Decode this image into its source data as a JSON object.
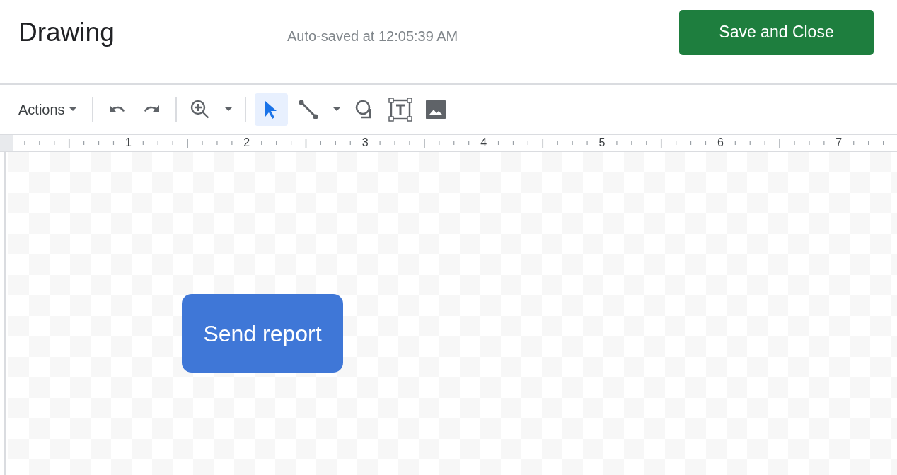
{
  "header": {
    "title": "Drawing",
    "status": "Auto-saved at 12:05:39 AM",
    "save_button": "Save and Close"
  },
  "toolbar": [
    {
      "kind": "menu",
      "label": "Actions"
    },
    {
      "kind": "divider"
    },
    {
      "kind": "tool",
      "selected": false
    },
    {
      "kind": "tool",
      "selected": false
    },
    {
      "kind": "divider"
    },
    {
      "kind": "tool",
      "selected": false
    },
    {
      "kind": "caret"
    },
    {
      "kind": "divider"
    },
    {
      "kind": "tool",
      "selected": true
    },
    {
      "kind": "tool",
      "selected": false
    },
    {
      "kind": "caret"
    },
    {
      "kind": "tool",
      "selected": false
    },
    {
      "kind": "tool",
      "selected": false
    },
    {
      "kind": "tool",
      "selected": false
    }
  ],
  "ruler": {
    "labels": [
      "1",
      "2",
      "3",
      "4",
      "5",
      "6",
      "7"
    ]
  },
  "canvas": {
    "shapes": [
      {
        "kind": "rounded_rectangle",
        "text": "Send report",
        "color": "#3f77d7"
      }
    ]
  }
}
